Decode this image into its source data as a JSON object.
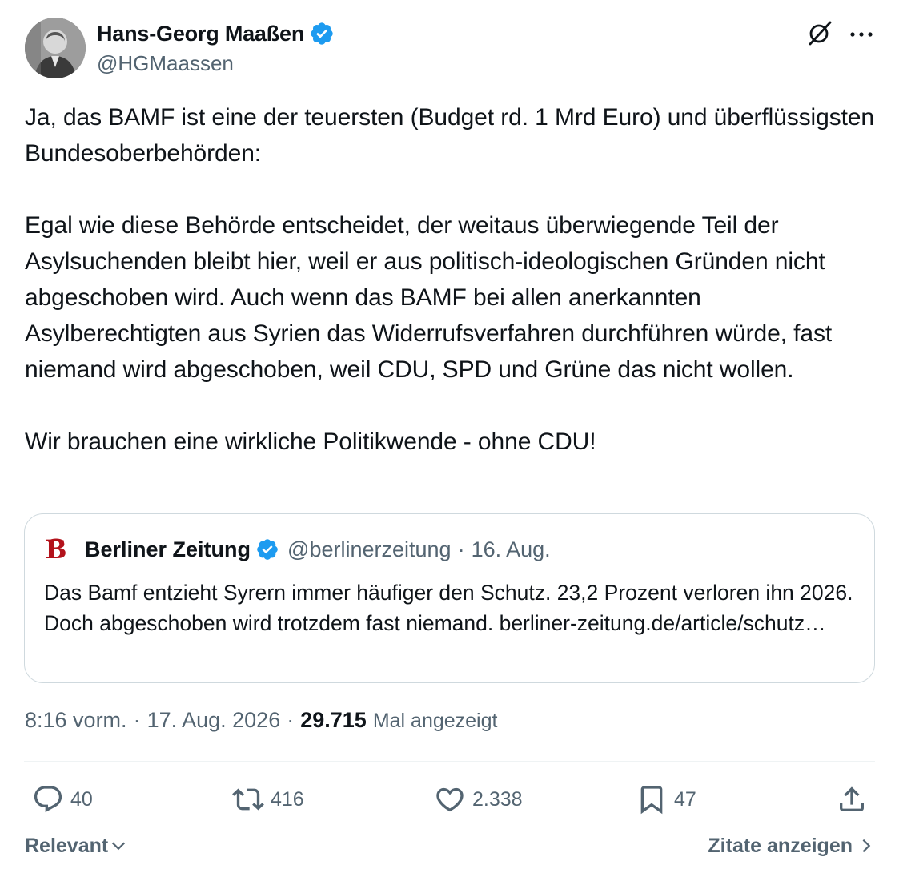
{
  "author": {
    "display_name": "Hans-Georg Maaßen",
    "handle": "@HGMaassen",
    "verified": true,
    "verified_color": "#1d9bf0"
  },
  "tweet": {
    "paragraphs": [
      "Ja, das BAMF ist eine der teuersten (Budget rd. 1 Mrd Euro) und überflüssigsten Bundesoberbehörden:",
      "Egal wie diese Behörde entscheidet, der weitaus überwiegende Teil der Asylsuchenden bleibt hier, weil er aus politisch-ideologischen Gründen nicht abgeschoben wird. Auch wenn das BAMF bei allen anerkannten Asylberechtigten aus Syrien das Widerrufsverfahren durchführen würde, fast niemand wird abgeschoben, weil CDU, SPD und Grüne das nicht wollen.",
      "Wir brauchen eine wirkliche Politikwende - ohne CDU!"
    ]
  },
  "quoted": {
    "name": "Berliner Zeitung",
    "handle": "@berlinerzeitung",
    "separator": "·",
    "date": "16. Aug.",
    "verified": true,
    "logo_icon": "berliner-zeitung-logo",
    "logo_color": "#b3121b",
    "text": "Das Bamf entzieht Syrern immer häufiger den Schutz. 23,2 Prozent verloren ihn 2026. Doch abgeschoben wird trotzdem fast niemand. berliner-zeitung.de/article/schutz…"
  },
  "meta": {
    "time": "8:16 vorm.",
    "separator": "·",
    "date": "17. Aug. 2026",
    "views": "29.715",
    "views_label": "Mal angezeigt"
  },
  "actions": {
    "replies": "40",
    "reposts": "416",
    "likes": "2.338",
    "bookmarks": "47"
  },
  "footer": {
    "sort_label": "Relevant",
    "quotes_label": "Zitate anzeigen"
  },
  "icons": [
    "grok-icon",
    "more-icon",
    "verified-badge-icon",
    "reply-icon",
    "repost-icon",
    "like-icon",
    "bookmark-icon",
    "share-icon",
    "chevron-down-icon",
    "chevron-right-icon"
  ],
  "colors": {
    "text": "#0f1419",
    "secondary": "#536471",
    "border": "#cfd9de"
  }
}
